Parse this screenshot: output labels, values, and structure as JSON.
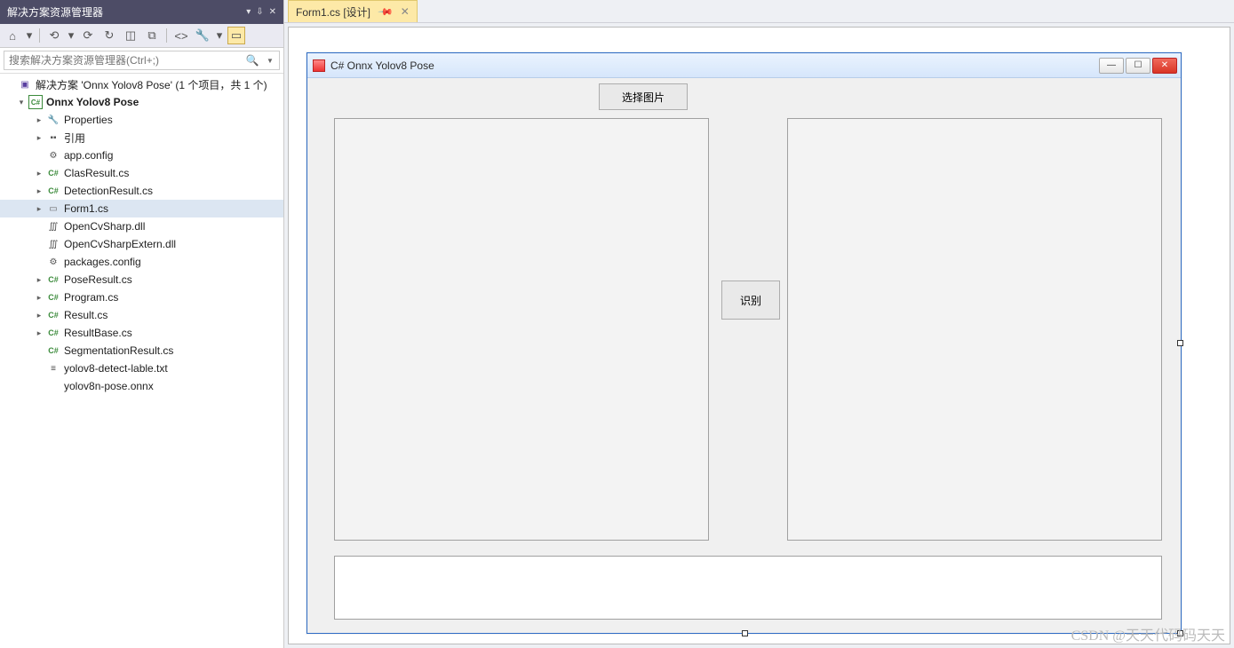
{
  "solution_explorer": {
    "title": "解决方案资源管理器",
    "search_placeholder": "搜索解决方案资源管理器(Ctrl+;)",
    "root_label": "解决方案 'Onnx Yolov8 Pose' (1 个项目，共 1 个)",
    "project_name": "Onnx Yolov8 Pose",
    "items": {
      "properties": "Properties",
      "references": "引用",
      "appconfig": "app.config",
      "clasresult": "ClasResult.cs",
      "detectionresult": "DetectionResult.cs",
      "form1": "Form1.cs",
      "opencvsharp": "OpenCvSharp.dll",
      "opencvsharpextern": "OpenCvSharpExtern.dll",
      "packages": "packages.config",
      "poseresult": "PoseResult.cs",
      "program": "Program.cs",
      "result": "Result.cs",
      "resultbase": "ResultBase.cs",
      "segmentationresult": "SegmentationResult.cs",
      "labeltxt": "yolov8-detect-lable.txt",
      "poseonnx": "yolov8n-pose.onnx"
    }
  },
  "tab": {
    "label": "Form1.cs [设计]"
  },
  "form": {
    "title": "C# Onnx Yolov8 Pose",
    "select_image_btn": "选择图片",
    "recognize_btn": "识别"
  },
  "watermark": "CSDN @天天代码码天天"
}
